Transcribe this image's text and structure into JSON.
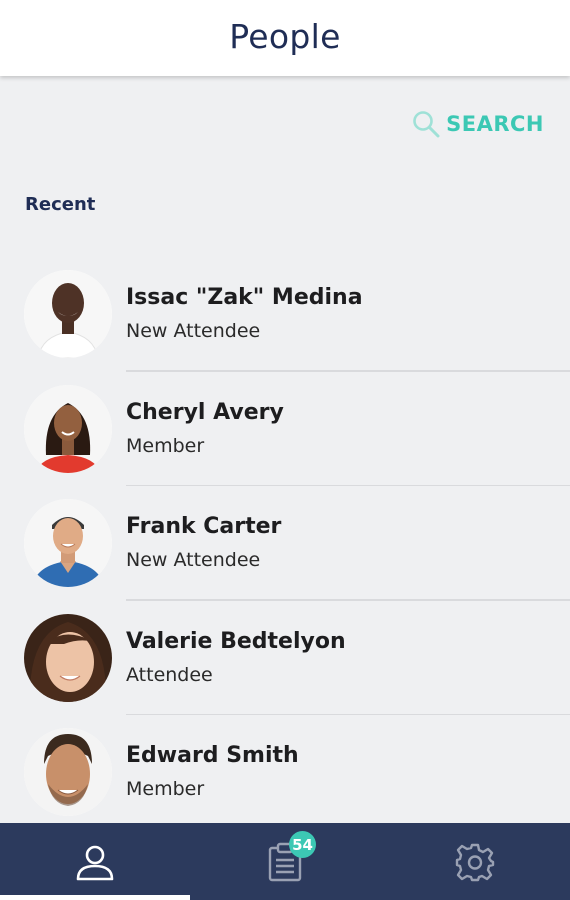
{
  "header": {
    "title": "People"
  },
  "search": {
    "label": "SEARCH",
    "icon": "search-icon",
    "color": "#3cc8b4"
  },
  "section": {
    "label": "Recent"
  },
  "people": [
    {
      "name": "Issac \"Zak\" Medina",
      "role": "New Attendee"
    },
    {
      "name": "Cheryl Avery",
      "role": "Member"
    },
    {
      "name": "Frank Carter",
      "role": "New Attendee"
    },
    {
      "name": "Valerie Bedtelyon",
      "role": "Attendee"
    },
    {
      "name": "Edward Smith",
      "role": "Member"
    }
  ],
  "bottom_nav": {
    "tabs": [
      {
        "icon": "person-icon",
        "active": true
      },
      {
        "icon": "clipboard-icon",
        "active": false
      },
      {
        "icon": "gear-icon",
        "active": false
      }
    ],
    "badge": "54",
    "background": "#2c3a5d"
  },
  "colors": {
    "accent": "#3cc8b4",
    "title": "#1f2d55",
    "background": "#eff0f2"
  }
}
